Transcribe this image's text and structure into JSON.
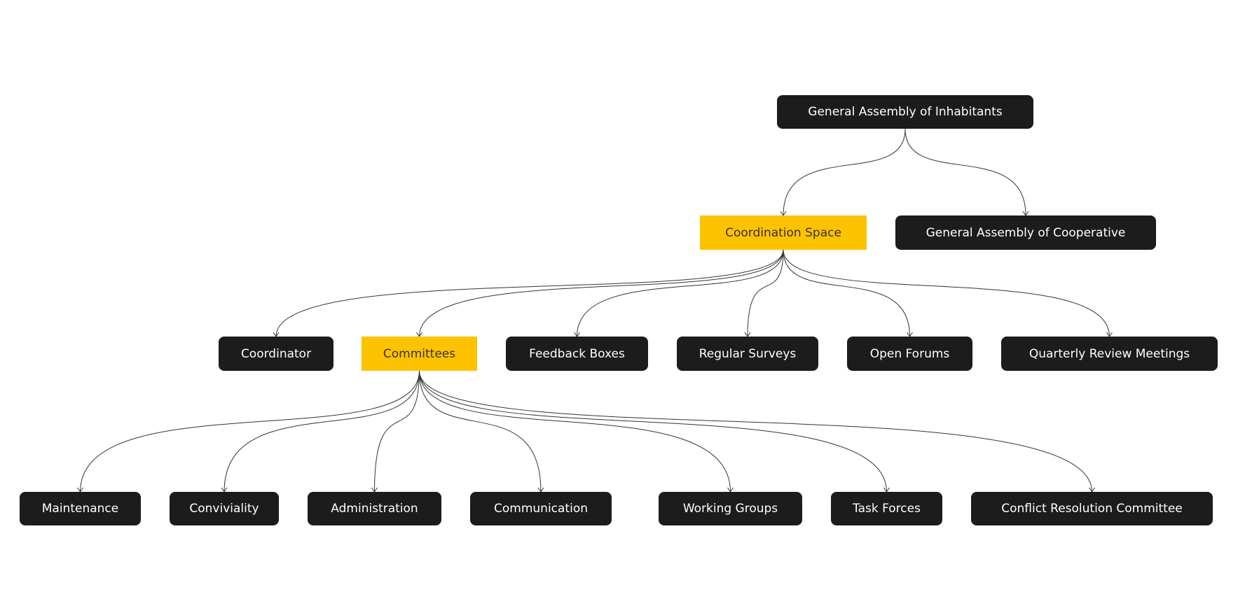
{
  "colors": {
    "dark": "#1c1c1c",
    "highlight": "#fdc300",
    "edge": "#333333"
  },
  "nodes": [
    {
      "id": "gai",
      "label": "General Assembly of Inhabitants",
      "style": "dark"
    },
    {
      "id": "cs",
      "label": "Coordination Space",
      "style": "hl"
    },
    {
      "id": "gac",
      "label": "General Assembly of Cooperative",
      "style": "dark"
    },
    {
      "id": "coord",
      "label": "Coordinator",
      "style": "dark"
    },
    {
      "id": "comm",
      "label": "Committees",
      "style": "hl"
    },
    {
      "id": "fb",
      "label": "Feedback Boxes",
      "style": "dark"
    },
    {
      "id": "rs",
      "label": "Regular Surveys",
      "style": "dark"
    },
    {
      "id": "of",
      "label": "Open Forums",
      "style": "dark"
    },
    {
      "id": "qrm",
      "label": "Quarterly Review Meetings",
      "style": "dark"
    },
    {
      "id": "mnt",
      "label": "Maintenance",
      "style": "dark"
    },
    {
      "id": "conv",
      "label": "Conviviality",
      "style": "dark"
    },
    {
      "id": "adm",
      "label": "Administration",
      "style": "dark"
    },
    {
      "id": "cmu",
      "label": "Communication",
      "style": "dark"
    },
    {
      "id": "wg",
      "label": "Working Groups",
      "style": "dark"
    },
    {
      "id": "tf",
      "label": "Task Forces",
      "style": "dark"
    },
    {
      "id": "crc",
      "label": "Conflict Resolution Committee",
      "style": "dark"
    }
  ],
  "edges": [
    [
      "gai",
      "cs"
    ],
    [
      "gai",
      "gac"
    ],
    [
      "cs",
      "coord"
    ],
    [
      "cs",
      "comm"
    ],
    [
      "cs",
      "fb"
    ],
    [
      "cs",
      "rs"
    ],
    [
      "cs",
      "of"
    ],
    [
      "cs",
      "qrm"
    ],
    [
      "comm",
      "mnt"
    ],
    [
      "comm",
      "conv"
    ],
    [
      "comm",
      "adm"
    ],
    [
      "comm",
      "cmu"
    ],
    [
      "comm",
      "wg"
    ],
    [
      "comm",
      "tf"
    ],
    [
      "comm",
      "crc"
    ]
  ]
}
